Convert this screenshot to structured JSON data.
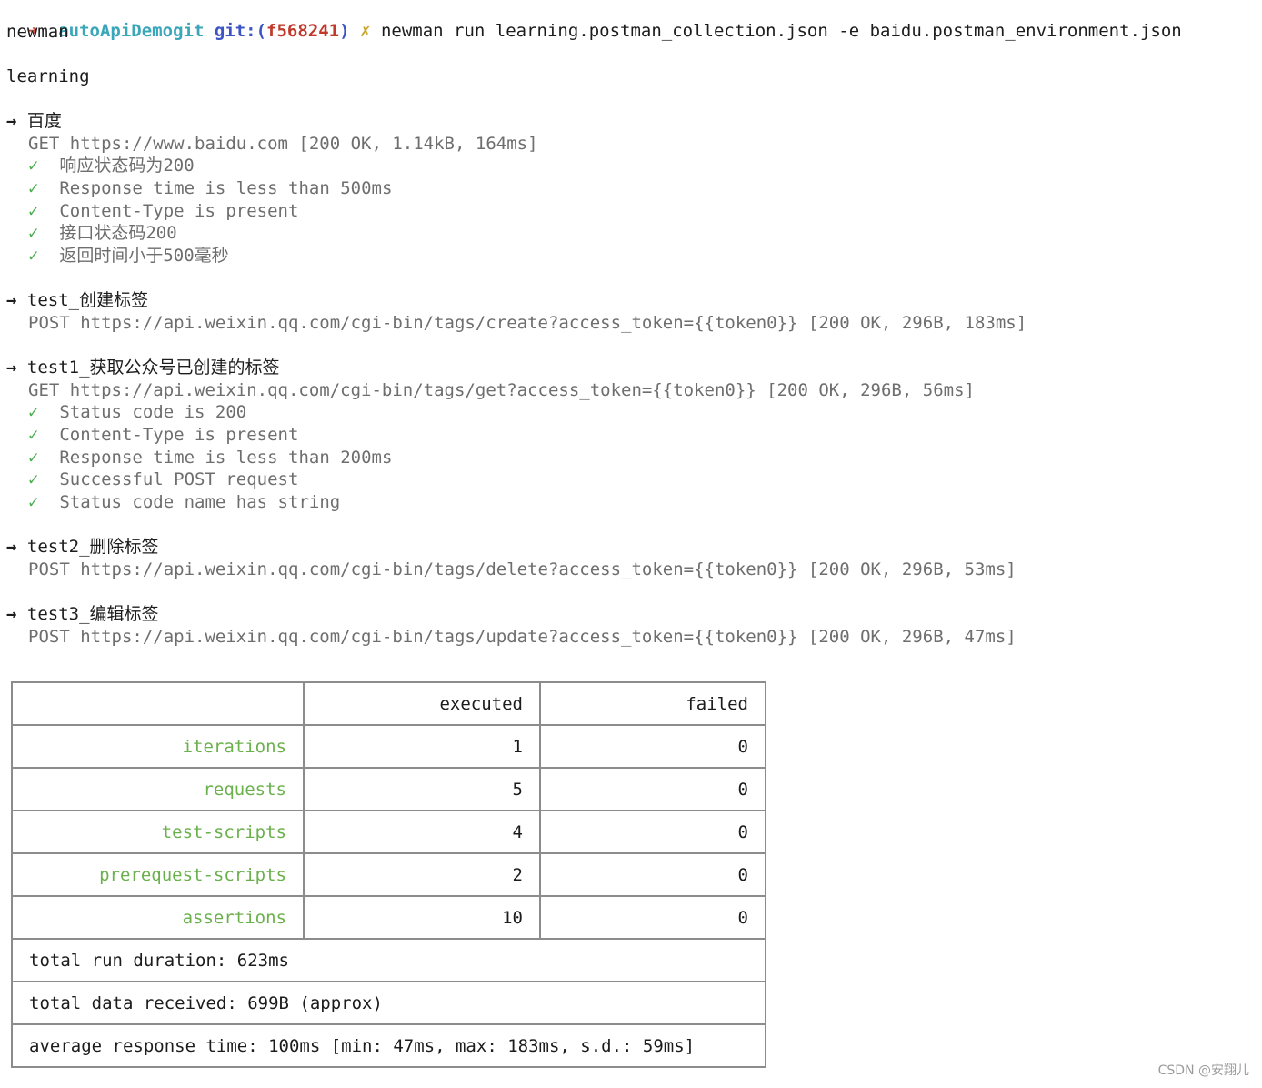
{
  "prompt": {
    "arrow": "➜",
    "dir": "autoApiDemogit",
    "git_label": "git:(",
    "branch": "f568241",
    "git_close": ")",
    "dirty_mark": "✗",
    "command": "newman run learning.postman_collection.json -e baidu.postman_environment.json"
  },
  "tool_name": "newman",
  "collection_name": "learning",
  "requests": [
    {
      "arrow": "→",
      "name": "百度",
      "line": "GET https://www.baidu.com [200 OK, 1.14kB, 164ms]",
      "assertions": [
        "响应状态码为200",
        "Response time is less than 500ms",
        "Content-Type is present",
        "接口状态码200",
        "返回时间小于500毫秒"
      ]
    },
    {
      "arrow": "→",
      "name": "test_创建标签",
      "line": "POST https://api.weixin.qq.com/cgi-bin/tags/create?access_token={{token0}} [200 OK, 296B, 183ms]",
      "assertions": []
    },
    {
      "arrow": "→",
      "name": "test1_获取公众号已创建的标签",
      "line": "GET https://api.weixin.qq.com/cgi-bin/tags/get?access_token={{token0}} [200 OK, 296B, 56ms]",
      "assertions": [
        "Status code is 200",
        "Content-Type is present",
        "Response time is less than 200ms",
        "Successful POST request",
        "Status code name has string"
      ]
    },
    {
      "arrow": "→",
      "name": "test2_删除标签",
      "line": "POST https://api.weixin.qq.com/cgi-bin/tags/delete?access_token={{token0}} [200 OK, 296B, 53ms]",
      "assertions": []
    },
    {
      "arrow": "→",
      "name": "test3_编辑标签",
      "line": "POST https://api.weixin.qq.com/cgi-bin/tags/update?access_token={{token0}} [200 OK, 296B, 47ms]",
      "assertions": []
    }
  ],
  "check_mark": "✓",
  "summary": {
    "headers": [
      "",
      "executed",
      "failed"
    ],
    "rows": [
      {
        "metric": "iterations",
        "executed": "1",
        "failed": "0"
      },
      {
        "metric": "requests",
        "executed": "5",
        "failed": "0"
      },
      {
        "metric": "test-scripts",
        "executed": "4",
        "failed": "0"
      },
      {
        "metric": "prerequest-scripts",
        "executed": "2",
        "failed": "0"
      },
      {
        "metric": "assertions",
        "executed": "10",
        "failed": "0"
      }
    ],
    "footer": [
      "total run duration: 623ms",
      "total data received: 699B (approx)",
      "average response time: 100ms [min: 47ms, max: 183ms, s.d.: 59ms]"
    ]
  },
  "watermark": "CSDN @安翔儿",
  "colors": {
    "prompt_dir": "#3aa6b9",
    "prompt_git": "#3b53c4",
    "prompt_branch": "#c0392b",
    "check": "#4caf50",
    "metric": "#6ab04c",
    "muted_text": "#6e6e6e",
    "border": "#8c8c8c"
  }
}
